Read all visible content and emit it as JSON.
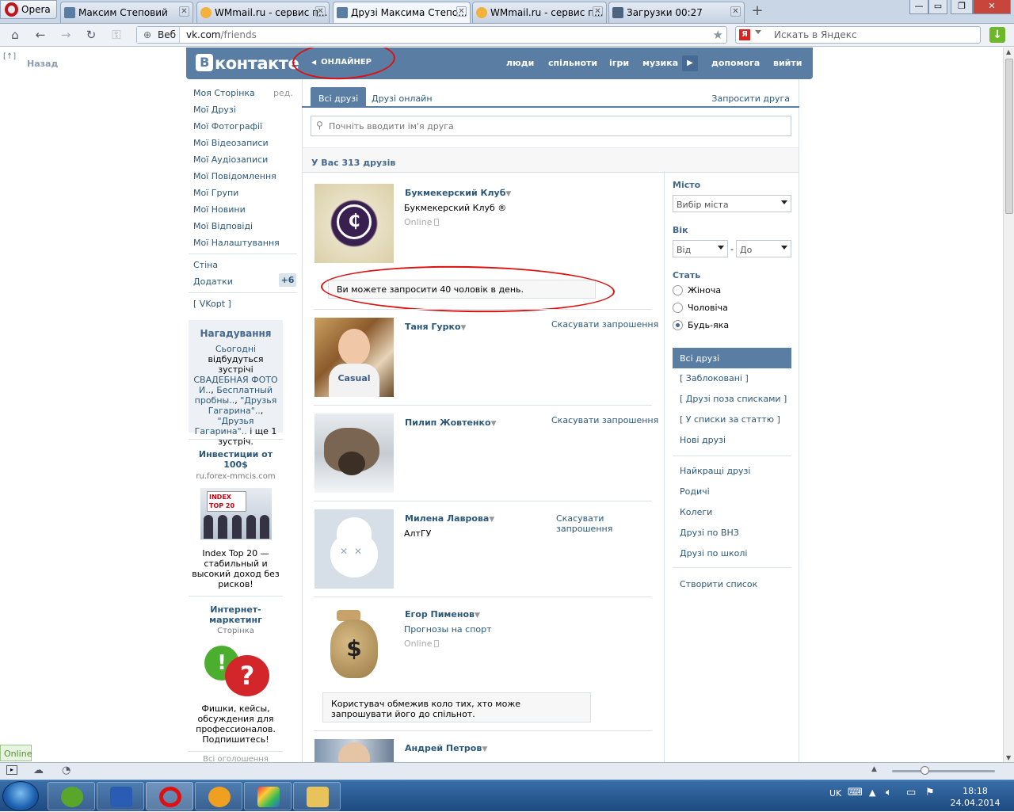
{
  "browser": {
    "menu_label": "Opera",
    "tabs": [
      {
        "label": "Максим Степовий",
        "icon": "vk-icon",
        "active": false
      },
      {
        "label": "WMmail.ru - сервис п...",
        "icon": "wmmail-icon",
        "active": false
      },
      {
        "label": "Друзі Максима Степо...",
        "icon": "vk-icon",
        "active": true
      },
      {
        "label": "WMmail.ru - сервис п...",
        "icon": "wmmail-icon",
        "active": false
      },
      {
        "label": "Загрузки 00:27",
        "icon": "downloads-icon",
        "active": false
      }
    ],
    "address_prefix": "Веб",
    "address_host": "vk.com",
    "address_path": "/friends",
    "search_placeholder": "Искать в Яндекс",
    "search_engine_glyph": "Я"
  },
  "page": {
    "back_label": "Назад",
    "back_arrow": "[↑]",
    "header": {
      "logo_letter": "В",
      "logo_text": "контакте",
      "player_label": "ОНЛАЙНЕР",
      "nav": [
        "люди",
        "спільноти",
        "ігри",
        "музика",
        "допомога",
        "вийти"
      ]
    },
    "left_menu": {
      "items": [
        "Моя Сторінка",
        "Мої Друзі",
        "Мої Фотографії",
        "Мої Відеозаписи",
        "Мої Аудіозаписи",
        "Мої Повідомлення",
        "Мої Групи",
        "Мої Новини",
        "Мої Відповіді",
        "Мої Налаштування"
      ],
      "edit_label": "ред.",
      "wall_label": "Стіна",
      "apps_label": "Додатки",
      "apps_badge": "+6",
      "vkopt_label": "[ VKopt ]"
    },
    "reminder": {
      "title": "Нагадування",
      "today_link": "Сьогодні",
      "text_1": "відбудуться зустрічі",
      "link_1": "СВАДЕБНАЯ ФОТО И..",
      "link_2": "Бесплатный пробны..",
      "link_3": "\"Друзья Гагарина\"..",
      "link_4": "\"Друзья Гагарина\"..",
      "text_2": "і ще 1 зустріч."
    },
    "ads": [
      {
        "title": "Инвестиции от 100$",
        "subtitle": "ru.forex-mmcis.com",
        "image_text": "INDEX TOP 20",
        "text": "Index Top 20 — стабильный и высокий доход без рисков!"
      },
      {
        "title": "Интернет-маркетинг",
        "subtitle": "Сторінка",
        "text": "Фишки, кейсы, обсуждения для профессионалов. Подпишитесь!"
      }
    ],
    "ads_all_label": "Всі оголошення",
    "tabs": {
      "all": "Всі друзі",
      "online": "Друзі онлайн",
      "invite": "Запросити друга"
    },
    "search_placeholder": "Почніть вводити ім'я друга",
    "count_text": "У Вас 313 друзів",
    "friends": [
      {
        "name": "Букмекерский Клуб",
        "subtitle": "Букмекерский Клуб ®",
        "status": "Online",
        "action": ""
      },
      {
        "name": "Таня Гурко",
        "subtitle": "",
        "status": "",
        "action": "Скасувати запрошення"
      },
      {
        "name": "Пилип Жовтенко",
        "subtitle": "",
        "status": "",
        "action": "Скасувати запрошення"
      },
      {
        "name": "Милена Лаврова",
        "subtitle": "АлтГУ",
        "status": "",
        "action": "Скасувати запрошення"
      },
      {
        "name": "Егор Пименов",
        "subtitle": "Прогнозы на спорт",
        "status": "Online",
        "action": ""
      },
      {
        "name": "Андрей Петров",
        "subtitle": "",
        "status": "",
        "action": ""
      }
    ],
    "notice_limit": "Ви можете запросити 40 чоловік в день.",
    "notice_restricted": "Користувач обмежив коло тих, хто може запрошувати його до спільнот.",
    "filters": {
      "city_label": "Місто",
      "city_value": "Вибір міста",
      "age_label": "Вік",
      "age_from": "Від",
      "age_dash": "-",
      "age_to": "До",
      "sex_label": "Стать",
      "sex_options": [
        "Жіноча",
        "Чоловіча",
        "Будь-яка"
      ],
      "sex_selected": "Будь-яка"
    },
    "lists": {
      "active": "Всі друзі",
      "group_1": [
        "[ Заблоковані ]",
        "[ Друзі поза списками ]",
        "[ У списки за статтю ]",
        "Нові друзі"
      ],
      "group_2": [
        "Найкращі друзі",
        "Родичі",
        "Колеги",
        "Друзі по ВНЗ",
        "Друзі по школі"
      ],
      "create": "Створити список"
    },
    "online_tag": "Online"
  },
  "taskbar": {
    "language": "UK",
    "time": "18:18",
    "date": "24.04.2014"
  },
  "colors": {
    "vk_header": "#597da3",
    "link": "#2b587a",
    "annotation": "#dd1111"
  }
}
